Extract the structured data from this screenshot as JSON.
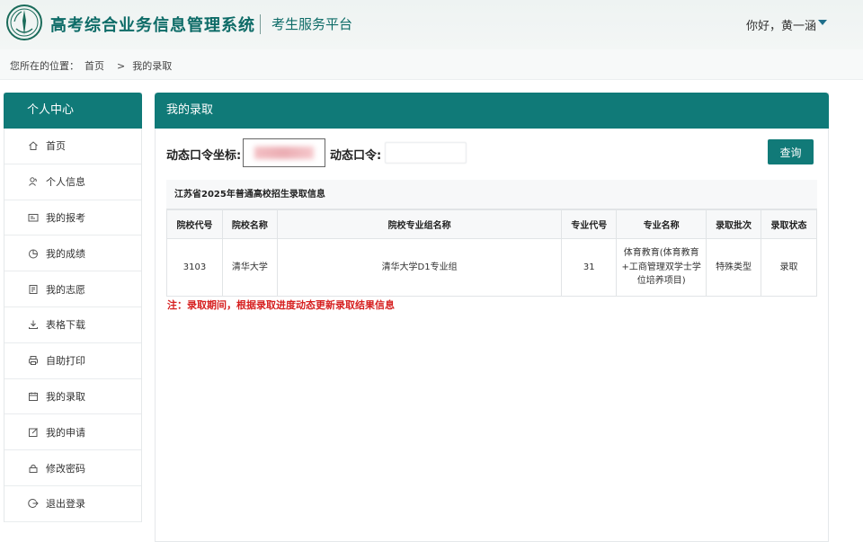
{
  "header": {
    "title": "高考综合业务信息管理系统",
    "subtitle": "考生服务平台",
    "greeting": "你好，黄一涵",
    "brand_color": "#107a78"
  },
  "breadcrumb": {
    "label": "您所在的位置：",
    "home": "首页",
    "separator": ">",
    "current": "我的录取"
  },
  "sidebar": {
    "title": "个人中心",
    "items": [
      {
        "label": "首页",
        "icon": "home-icon"
      },
      {
        "label": "个人信息",
        "icon": "user-icon"
      },
      {
        "label": "我的报考",
        "icon": "id-card-icon"
      },
      {
        "label": "我的成绩",
        "icon": "pie-chart-icon"
      },
      {
        "label": "我的志愿",
        "icon": "document-icon"
      },
      {
        "label": "表格下载",
        "icon": "download-icon"
      },
      {
        "label": "自助打印",
        "icon": "printer-icon"
      },
      {
        "label": "我的录取",
        "icon": "calendar-icon"
      },
      {
        "label": "我的申请",
        "icon": "edit-icon"
      },
      {
        "label": "修改密码",
        "icon": "lock-icon"
      },
      {
        "label": "退出登录",
        "icon": "logout-icon"
      }
    ]
  },
  "main": {
    "title": "我的录取",
    "token_coord_label": "动态口令坐标:",
    "token_label": "动态口令:",
    "query_button": "查询",
    "table": {
      "caption": "江苏省2025年普通高校招生录取信息",
      "headers": [
        "院校代号",
        "院校名称",
        "院校专业组名称",
        "专业代号",
        "专业名称",
        "录取批次",
        "录取状态"
      ],
      "rows": [
        [
          "3103",
          "清华大学",
          "清华大学D1专业组",
          "31",
          "体育教育(体育教育+工商管理双学士学位培养项目)",
          "特殊类型",
          "录取"
        ]
      ]
    },
    "note": "注：录取期间，根据录取进度动态更新录取结果信息",
    "note_color": "#d62020"
  }
}
